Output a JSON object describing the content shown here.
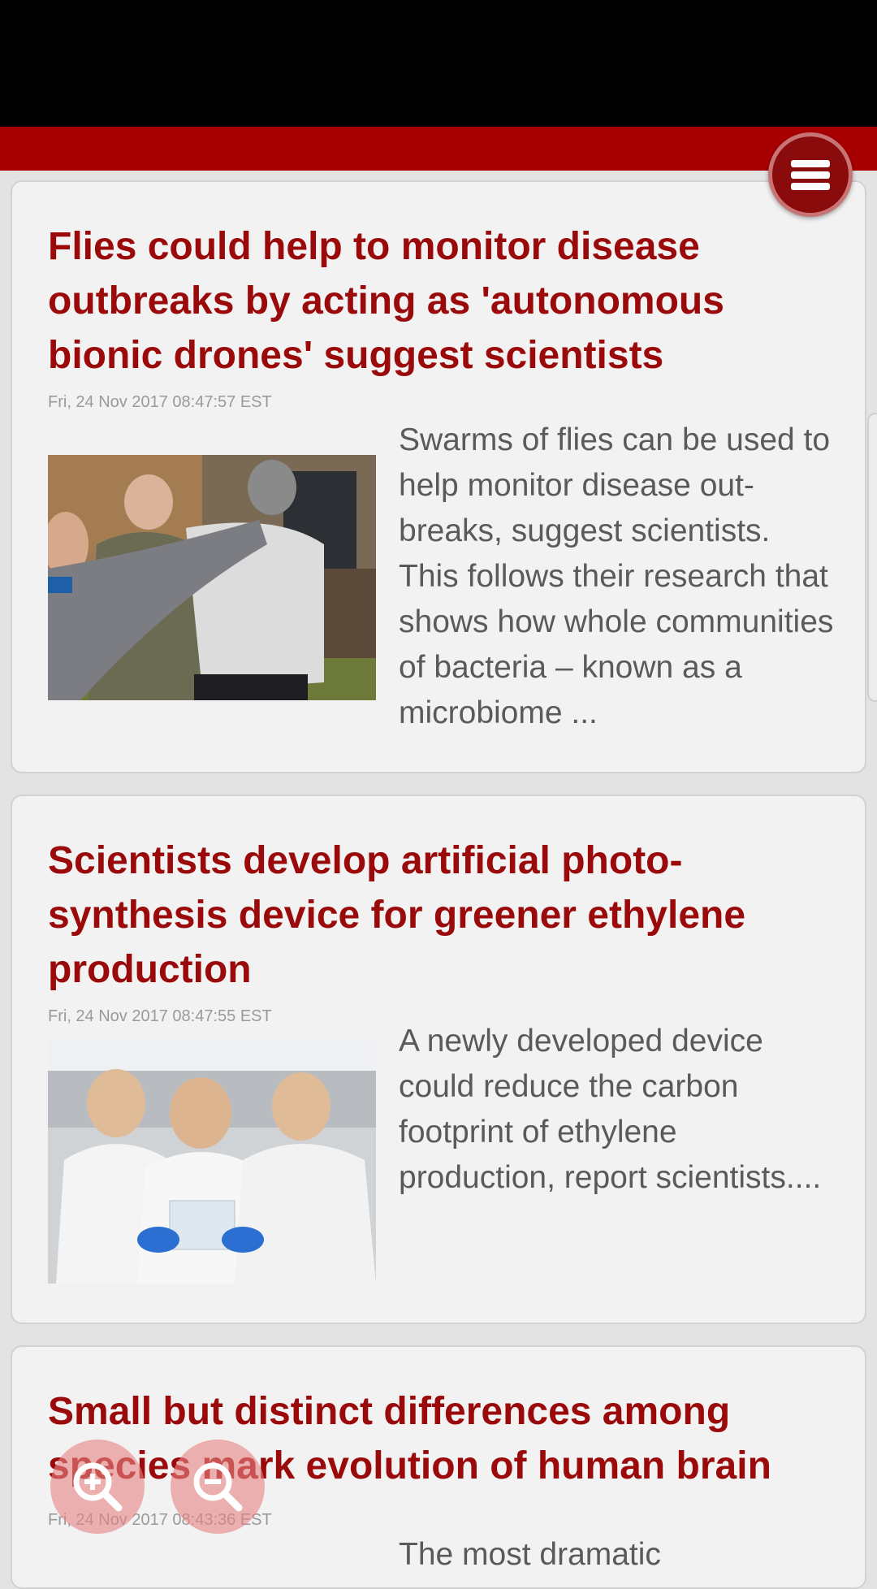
{
  "articles": [
    {
      "title": "Flies could help to monitor disease outbreaks by acting as 'autonomous bionic drones' suggest scientists",
      "date": "Fri, 24 Nov 2017 08:47:57 EST",
      "summary": "Swarms of flies can be used to help monitor disease out-breaks, suggest scientists. This follows their research that shows how whole communities of bacteria – known as a microbiome ..."
    },
    {
      "title": "Scientists develop artificial photo-synthesis device for greener ethylene production",
      "date": "Fri, 24 Nov 2017 08:47:55 EST",
      "summary": "A newly developed device could reduce the carbon footprint of ethylene production, report scientists...."
    },
    {
      "title": "Small but distinct differences among species mark evolution of human brain",
      "date": "Fri, 24 Nov 2017 08:43:36 EST",
      "summary": "The most dramatic"
    }
  ],
  "icons": {
    "menu": "hamburger-menu-icon",
    "zoom_in": "zoom-in-icon",
    "zoom_out": "zoom-out-icon"
  },
  "colors": {
    "header_red": "#a80000",
    "title_red": "#9b0a0a",
    "card_bg": "#f2f2f2",
    "page_bg": "#e3e3e3"
  }
}
